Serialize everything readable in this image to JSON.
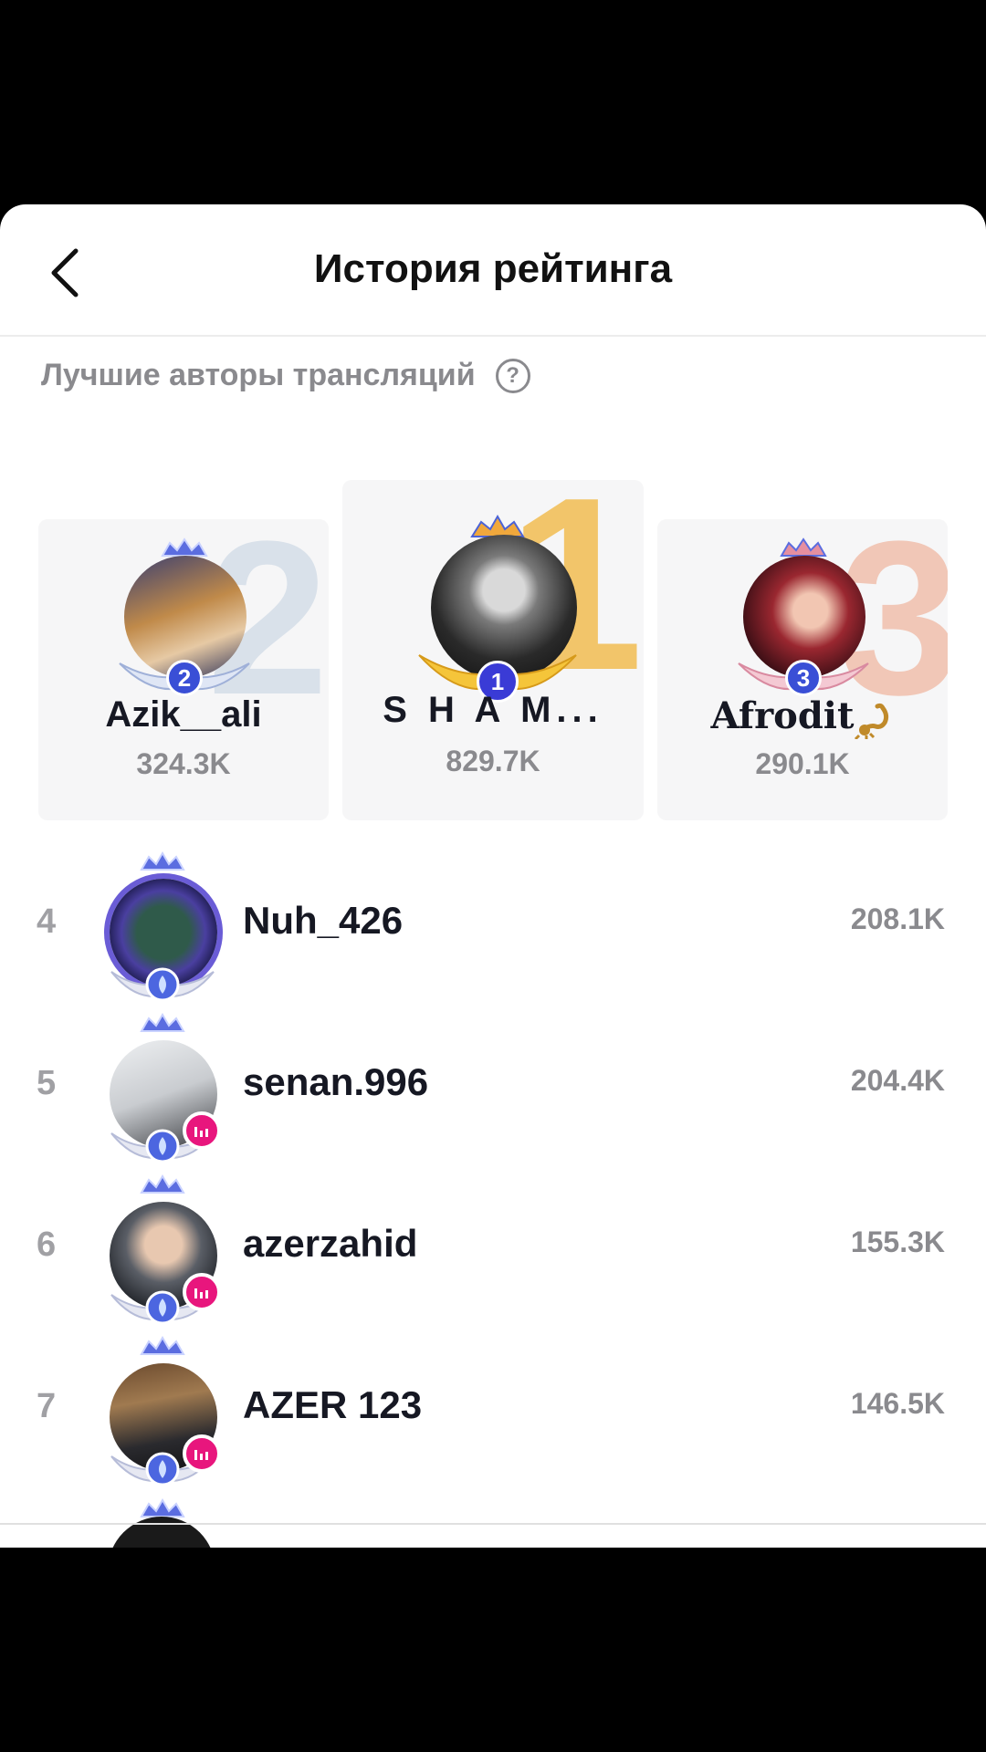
{
  "header": {
    "title": "История рейтинга",
    "back_icon": "chevron-left-icon"
  },
  "section": {
    "title": "Лучшие авторы трансляций",
    "help_icon": "?"
  },
  "podium": [
    {
      "rank": "2",
      "big_digit": "2",
      "name": "Azik__ali",
      "score": "324.3K"
    },
    {
      "rank": "1",
      "big_digit": "1",
      "name": "S H A M...",
      "score": "829.7K"
    },
    {
      "rank": "3",
      "big_digit": "3",
      "name": "Afrodit",
      "score": "290.1K"
    }
  ],
  "list": [
    {
      "rank": "4",
      "name": "Nuh_426",
      "score": "208.1K",
      "live": false
    },
    {
      "rank": "5",
      "name": "senan.996",
      "score": "204.4K",
      "live": true
    },
    {
      "rank": "6",
      "name": "azerzahid",
      "score": "155.3K",
      "live": true
    },
    {
      "rank": "7",
      "name": "AZER 123",
      "score": "146.5K",
      "live": true
    }
  ],
  "colors": {
    "live_badge": "#e8167d",
    "gold": "#f2c56a",
    "silver": "#d9e1ea",
    "bronze": "#f1c7b7",
    "rank_badge": "#3a4fd6"
  }
}
